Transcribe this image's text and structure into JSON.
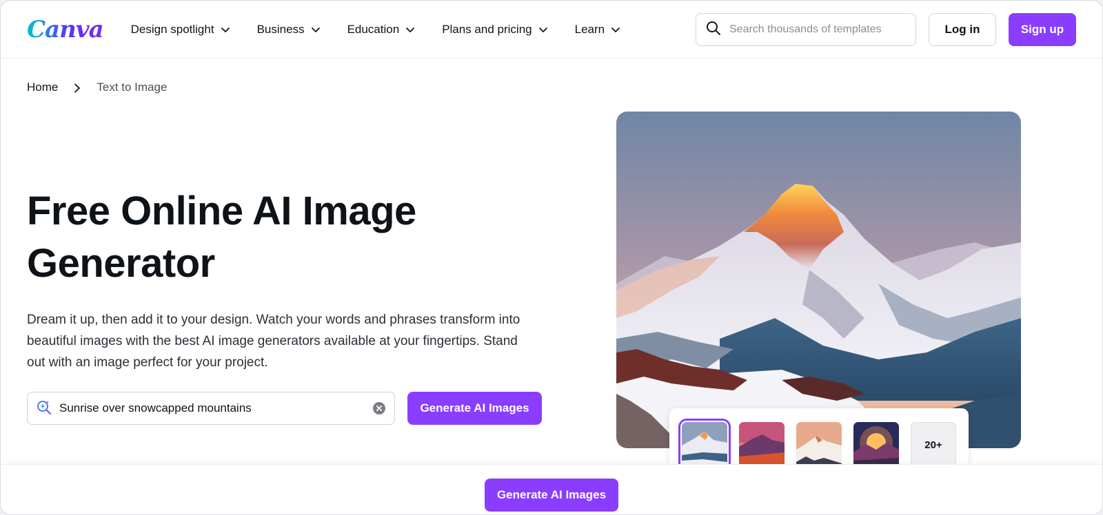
{
  "brand": {
    "logo_text": "Canva",
    "accent": "#8b3dff"
  },
  "nav": {
    "items": [
      {
        "label": "Design spotlight"
      },
      {
        "label": "Business"
      },
      {
        "label": "Education"
      },
      {
        "label": "Plans and pricing"
      },
      {
        "label": "Learn"
      }
    ]
  },
  "search": {
    "placeholder": "Search thousands of templates",
    "value": ""
  },
  "auth": {
    "login_label": "Log in",
    "signup_label": "Sign up"
  },
  "breadcrumb": {
    "home": "Home",
    "current": "Text to Image"
  },
  "hero": {
    "title_line1": "Free Online AI Image",
    "title_line2": "Generator",
    "description": "Dream it up, then add it to your design. Watch your words and phrases transform into beautiful images with the best AI image generators available at your fingertips. Stand out with an image perfect for your project.",
    "prompt_value": "Sunrise over snowcapped mountains",
    "generate_label": "Generate AI Images"
  },
  "thumbnails": {
    "more_label": "20+"
  },
  "bottom_bar": {
    "generate_label": "Generate AI Images"
  }
}
